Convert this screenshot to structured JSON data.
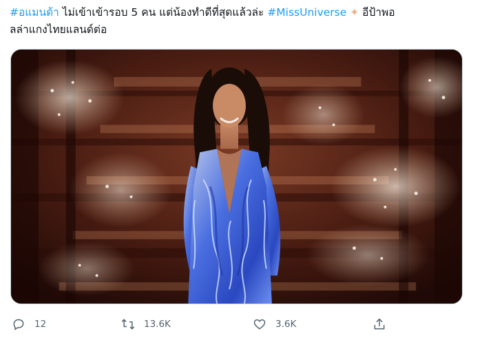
{
  "tweet": {
    "hashtag_1": "#อแมนด้า",
    "text_1": " ไม่เข้าเข้ารอบ 5 คน แต่น้องทำดีที่สุดแล้วล่ะ ",
    "hashtag_2": "#MissUniverse",
    "sparkle": "✦",
    "text_2": " อีป้าพอ",
    "text_3": "ลล่าแกงไทยแลนด์ต่อ"
  },
  "actions": {
    "reply_count": "12",
    "retweet_count": "13.6K",
    "like_count": "3.6K"
  },
  "icons": {
    "reply": "reply-icon",
    "retweet": "retweet-icon",
    "like": "heart-icon",
    "share": "share-icon"
  },
  "colors": {
    "hashtag": "#1d9bf0",
    "text": "#0f1419",
    "muted": "#536471",
    "dress": "#3a5fd8"
  }
}
